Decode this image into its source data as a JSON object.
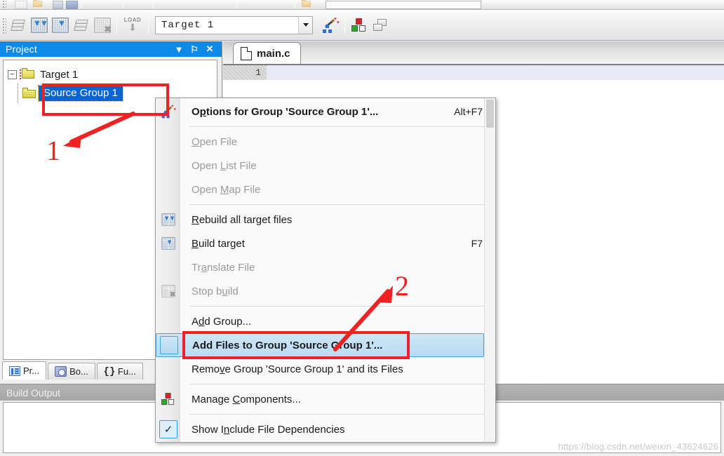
{
  "toolbar": {
    "target_selector": {
      "value": "Target 1",
      "dropdown_icon": "chevron-down-icon"
    },
    "buttons": [
      {
        "name": "batch-build",
        "icon": "stack-icon",
        "label": "Batch Build"
      },
      {
        "name": "rebuild-all",
        "icon": "rebuild-grid-icon",
        "label": "Rebuild"
      },
      {
        "name": "build-target",
        "icon": "build-grid-icon",
        "label": "Build"
      },
      {
        "name": "translate",
        "icon": "layers-icon",
        "label": "Translate"
      },
      {
        "name": "stop-build",
        "icon": "grid-stop-icon",
        "label": "Stop Build"
      },
      {
        "name": "download",
        "icon": "load-icon",
        "label": "LOAD"
      },
      {
        "name": "configure-target",
        "icon": "magic-wand-icon",
        "label": "Options for Target"
      },
      {
        "name": "manage-components",
        "icon": "components-icon",
        "label": "Manage Components"
      },
      {
        "name": "manage-multi-project",
        "icon": "windows-icon",
        "label": "Multi-Project"
      }
    ]
  },
  "project_panel": {
    "title": "Project",
    "header_buttons": [
      {
        "name": "panel-menu-button",
        "glyph": "▼"
      },
      {
        "name": "panel-pin-button",
        "glyph": "⚐"
      },
      {
        "name": "panel-close-button",
        "glyph": "✕"
      }
    ],
    "tree": {
      "root": {
        "label": "Target 1",
        "expander": "−",
        "icon": "target-folder-icon"
      },
      "child": {
        "label": "Source Group 1",
        "icon": "folder-icon",
        "selected": true
      }
    },
    "tabs": [
      {
        "name": "tab-project",
        "label": "Pr...",
        "icon": "project-icon",
        "active": true
      },
      {
        "name": "tab-books",
        "label": "Bo...",
        "icon": "books-icon",
        "active": false
      },
      {
        "name": "tab-functions",
        "label": "Fu...",
        "icon": "braces-icon",
        "active": false
      }
    ]
  },
  "editor": {
    "tab": {
      "label": "main.c",
      "icon": "document-icon"
    },
    "line_number": "1"
  },
  "build_output": {
    "title": "Build Output"
  },
  "context_menu": {
    "items": [
      {
        "name": "menu-options-for-group",
        "label_pre": "O",
        "label_accel": "p",
        "label_post": "tions for Group 'Source Group 1'...",
        "accel": "Alt+F7",
        "icon": "magic-wand-icon",
        "state": "bold"
      },
      {
        "type": "separator"
      },
      {
        "name": "menu-open-file",
        "label_pre": "",
        "label_accel": "O",
        "label_post": "pen File",
        "accel": "",
        "icon": "",
        "state": "disabled"
      },
      {
        "name": "menu-open-list-file",
        "label_pre": "Open ",
        "label_accel": "L",
        "label_post": "ist File",
        "accel": "",
        "icon": "",
        "state": "disabled"
      },
      {
        "name": "menu-open-map-file",
        "label_pre": "Open ",
        "label_accel": "M",
        "label_post": "ap File",
        "accel": "",
        "icon": "",
        "state": "disabled"
      },
      {
        "type": "separator"
      },
      {
        "name": "menu-rebuild-all-target-files",
        "label_pre": "",
        "label_accel": "R",
        "label_post": "ebuild all target files",
        "accel": "",
        "icon": "rebuild-grid-icon",
        "state": "normal"
      },
      {
        "name": "menu-build-target",
        "label_pre": "",
        "label_accel": "B",
        "label_post": "uild target",
        "accel": "F7",
        "icon": "build-grid-icon",
        "state": "normal"
      },
      {
        "name": "menu-translate-file",
        "label_pre": "Tr",
        "label_accel": "a",
        "label_post": "nslate File",
        "accel": "",
        "icon": "",
        "state": "disabled"
      },
      {
        "name": "menu-stop-build",
        "label_pre": "Stop b",
        "label_accel": "u",
        "label_post": "ild",
        "accel": "",
        "icon": "grid-stop-icon",
        "state": "disabled"
      },
      {
        "type": "separator"
      },
      {
        "name": "menu-add-group",
        "label_pre": "A",
        "label_accel": "d",
        "label_post": "d Group...",
        "accel": "",
        "icon": "",
        "state": "normal"
      },
      {
        "name": "menu-add-files-to-group",
        "label_pre": "Add Files to Group 'Source Group 1'...",
        "label_accel": "",
        "label_post": "",
        "accel": "",
        "icon": "selected-box-icon",
        "state": "highlight"
      },
      {
        "name": "menu-remove-group",
        "label_pre": "Remo",
        "label_accel": "v",
        "label_post": "e Group 'Source Group 1' and its Files",
        "accel": "",
        "icon": "",
        "state": "normal"
      },
      {
        "type": "separator"
      },
      {
        "name": "menu-manage-components",
        "label_pre": "Manage ",
        "label_accel": "C",
        "label_post": "omponents...",
        "accel": "",
        "icon": "components-icon",
        "state": "normal"
      },
      {
        "type": "separator"
      },
      {
        "name": "menu-show-include-file-dependencies",
        "label_pre": "Show I",
        "label_accel": "n",
        "label_post": "clude File Dependencies",
        "accel": "",
        "icon": "checkmark-icon",
        "state": "normal"
      }
    ]
  },
  "annotations": {
    "marker_one": "1",
    "marker_two": "2",
    "color": "#ee2222"
  },
  "watermark": {
    "text": "https://blog.csdn.net/weixin_43624626"
  },
  "colors": {
    "panel_header": "#0d8ae8",
    "tree_selection": "#0a64d2",
    "menu_highlight": "#b9dcf4",
    "annotation_red": "#ee2222"
  }
}
